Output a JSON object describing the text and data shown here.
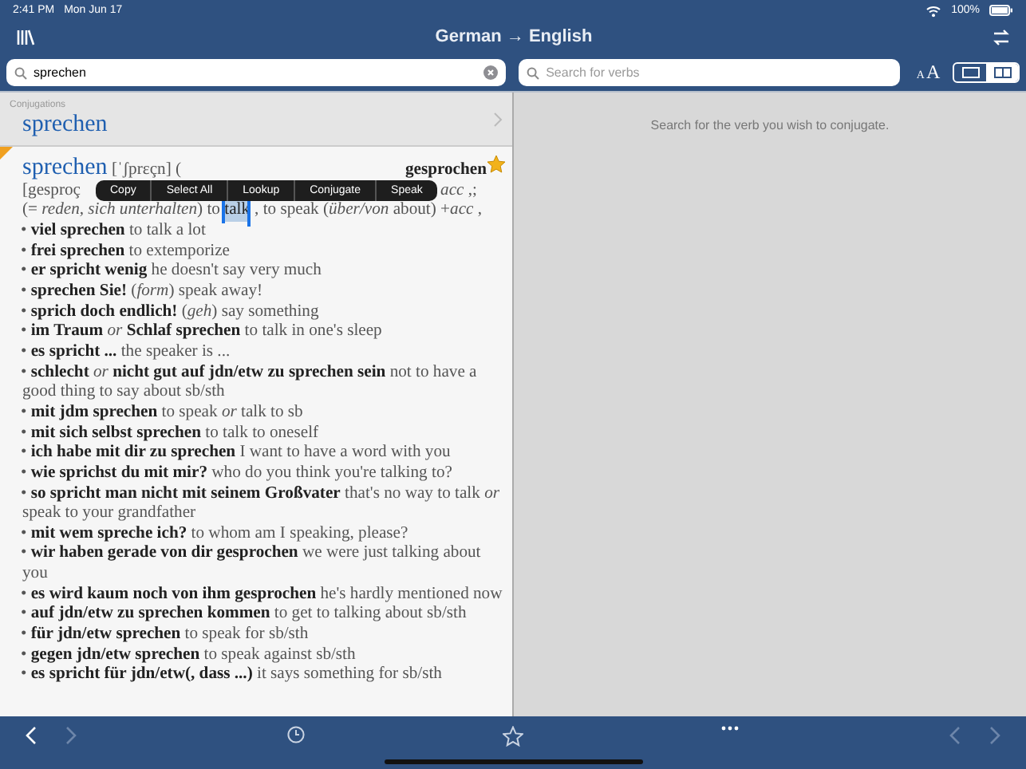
{
  "status_bar": {
    "time": "2:41 PM",
    "date": "Mon Jun 17",
    "battery": "100%"
  },
  "nav_bar": {
    "title": "German → English"
  },
  "search": {
    "value": "sprechen"
  },
  "verb_search": {
    "placeholder": "Search for verbs"
  },
  "text_size": {
    "small": "A",
    "large": "A"
  },
  "view_toggle": [
    {
      "kind": "single",
      "selected": false
    },
    {
      "kind": "split",
      "selected": true
    }
  ],
  "conjugations": {
    "label": "Conjugations",
    "verb": "sprechen"
  },
  "entry": {
    "headword": "sprechen",
    "pronunciation": "[ˈʃprɛçn] (",
    "ptp": "gesprochen",
    "ptp_pron": "[gesproç",
    "line2_end": "*acc* ,;",
    "favorite": true,
    "bullet": "•",
    "sense_prefix": "(= *reden, sich unterhalten*) to",
    "selected_word": "talk",
    "sense_suffix": ", to speak (*über/von* about) +*acc* ,",
    "examples": [
      "**viel sprechen** to talk a lot",
      "**frei sprechen** to extemporize",
      "**er spricht wenig** he doesn't say very much",
      "**sprechen Sie!** (*form*) speak away!",
      "**sprich doch endlich!** (*geh*) say something",
      "**im Traum** *or* **Schlaf sprechen** to talk in one's sleep",
      "**es spricht ...** the speaker is ...",
      "**schlecht** *or* **nicht gut auf jdn/etw zu sprechen sein** not to have a good thing to say about sb/sth",
      "**mit jdm sprechen** to speak *or* talk to sb",
      "**mit sich selbst sprechen** to talk to oneself",
      "**ich habe mit dir zu sprechen** I want to have a word with you",
      "**wie sprichst du mit mir?** who do you think you're talking to?",
      "**so spricht man nicht mit seinem Großvater** that's no way to talk *or* speak to your grandfather",
      "**mit wem spreche ich?** to whom am I speaking, please?",
      "**wir haben gerade von dir gesprochen** we were just talking about you",
      "**es wird kaum noch von ihm gesprochen** he's hardly mentioned now",
      "**auf jdn/etw zu sprechen kommen** to get to talking about sb/sth",
      "**für jdn/etw sprechen** to speak for sb/sth",
      "**gegen jdn/etw sprechen** to speak against sb/sth",
      "**es spricht für jdn/etw(, dass ...)** it says something for sb/sth"
    ]
  },
  "context_menu": [
    "Copy",
    "Select All",
    "Lookup",
    "Conjugate",
    "Speak"
  ],
  "right_pane": {
    "message": "Search for the verb you wish to conjugate."
  },
  "bottom_bar": {
    "back_enabled": true,
    "forward_enabled": false,
    "right_back_enabled": false,
    "right_forward_enabled": false
  }
}
